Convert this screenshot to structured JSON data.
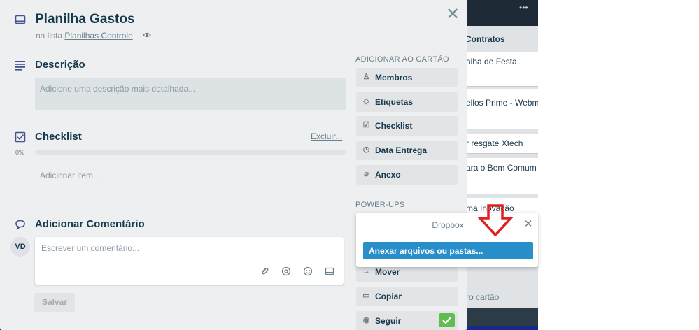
{
  "board": {
    "list_title": "Contratos",
    "cards": [
      "alha de Festa",
      "ellos Prime - Webm",
      "r resgate Xtech",
      "ara o Bem Comum",
      "ma Inovação"
    ],
    "add_card": "ro cartão"
  },
  "card": {
    "title": "Planilha Gastos",
    "in_list_prefix": "na lista",
    "list_name": "Planilhas Controle"
  },
  "description": {
    "title": "Descrição",
    "placeholder": "Adicione uma descrição mais detalhada..."
  },
  "checklist": {
    "title": "Checklist",
    "delete_label": "Excluir...",
    "percent_label": "0%",
    "progress_fraction": 0,
    "add_item": "Adicionar item..."
  },
  "comment": {
    "title": "Adicionar Comentário",
    "avatar_initials": "VD",
    "placeholder": "Escrever um comentário...",
    "save_label": "Salvar"
  },
  "sidebar": {
    "add_heading": "ADICIONAR AO CARTÃO",
    "add_items": [
      {
        "label": "Membros",
        "icon": "person-icon"
      },
      {
        "label": "Etiquetas",
        "icon": "tag-icon"
      },
      {
        "label": "Checklist",
        "icon": "checkbox-icon"
      },
      {
        "label": "Data Entrega",
        "icon": "clock-icon"
      },
      {
        "label": "Anexo",
        "icon": "paperclip-icon"
      }
    ],
    "powerups_heading": "POWER-UPS",
    "action_items": [
      {
        "label": "Mover",
        "icon": "arrow-right-icon"
      },
      {
        "label": "Copiar",
        "icon": "card-icon"
      },
      {
        "label": "Seguir",
        "icon": "eye-icon"
      }
    ]
  },
  "popover": {
    "title": "Dropbox",
    "button_label": "Anexar arquivos ou pastas..."
  },
  "colors": {
    "modal_bg": "#edeff0",
    "primary_blue": "#298fca",
    "success_green": "#61bd4f",
    "annotation_red": "#e02020"
  }
}
